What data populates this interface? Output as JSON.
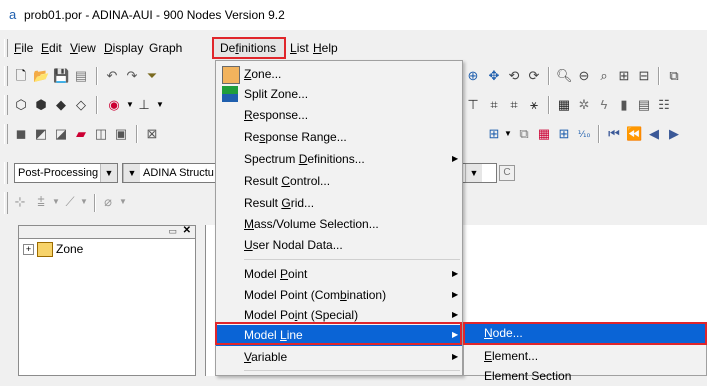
{
  "window": {
    "title": "prob01.por - ADINA-AUI - 900 Nodes Version 9.2",
    "app_icon_glyph": "a"
  },
  "menubar": {
    "items": [
      {
        "label": "File",
        "u": "F",
        "rest": "ile"
      },
      {
        "label": "Edit",
        "u": "E",
        "rest": "dit"
      },
      {
        "label": "View",
        "u": "V",
        "rest": "iew"
      },
      {
        "label": "Display",
        "u": "D",
        "rest": "isplay"
      },
      {
        "label": "Graph",
        "u": "",
        "rest": "Graph"
      },
      {
        "label": "Definitions",
        "pre": "De",
        "u": "f",
        "rest": "initions"
      },
      {
        "label": "List",
        "u": "L",
        "rest": "ist"
      },
      {
        "label": "Help",
        "u": "H",
        "rest": "elp"
      }
    ]
  },
  "toolbar": {
    "mode_combo": "Post-Processing",
    "structure_combo": "ADINA Structu"
  },
  "tree": {
    "root_label": "Zone",
    "expand_glyph": "+"
  },
  "definitions_menu": {
    "items": [
      {
        "pre": "",
        "u": "Z",
        "post": "one...",
        "label": "Zone...",
        "submenu": false
      },
      {
        "pre": "Split Zone...",
        "u": "",
        "post": "",
        "label": "Split Zone...",
        "submenu": false
      },
      {
        "pre": "",
        "u": "R",
        "post": "esponse...",
        "label": "Response...",
        "submenu": false
      },
      {
        "pre": "Re",
        "u": "s",
        "post": "ponse Range...",
        "label": "Response Range...",
        "submenu": false
      },
      {
        "pre": "Spectrum ",
        "u": "D",
        "post": "efinitions...",
        "label": "Spectrum Definitions...",
        "submenu": true
      },
      {
        "pre": "Result ",
        "u": "C",
        "post": "ontrol...",
        "label": "Result Control...",
        "submenu": false
      },
      {
        "pre": "Result ",
        "u": "G",
        "post": "rid...",
        "label": "Result Grid...",
        "submenu": false
      },
      {
        "pre": "",
        "u": "M",
        "post": "ass/Volume Selection...",
        "label": "Mass/Volume Selection...",
        "submenu": false
      },
      {
        "pre": "",
        "u": "U",
        "post": "ser Nodal Data...",
        "label": "User Nodal Data...",
        "submenu": false
      },
      {
        "pre": "Model ",
        "u": "P",
        "post": "oint",
        "label": "Model Point",
        "submenu": true
      },
      {
        "pre": "Model Point (Com",
        "u": "b",
        "post": "ination)",
        "label": "Model Point (Combination)",
        "submenu": true
      },
      {
        "pre": "Model Po",
        "u": "i",
        "post": "nt (Special)",
        "label": "Model Point (Special)",
        "submenu": true
      },
      {
        "pre": "Model ",
        "u": "L",
        "post": "ine",
        "label": "Model Line",
        "submenu": true
      },
      {
        "pre": "",
        "u": "V",
        "post": "ariable",
        "label": "Variable",
        "submenu": true
      }
    ]
  },
  "model_line_submenu": {
    "items": [
      {
        "pre": "",
        "u": "N",
        "post": "ode...",
        "label": "Node..."
      },
      {
        "pre": "",
        "u": "E",
        "post": "lement...",
        "label": "Element..."
      },
      {
        "pre": "Element Section",
        "u": "",
        "post": "",
        "label": "Element Section..."
      }
    ]
  },
  "colors": {
    "highlight": "#0a64d6",
    "callout": "#e0262b"
  }
}
